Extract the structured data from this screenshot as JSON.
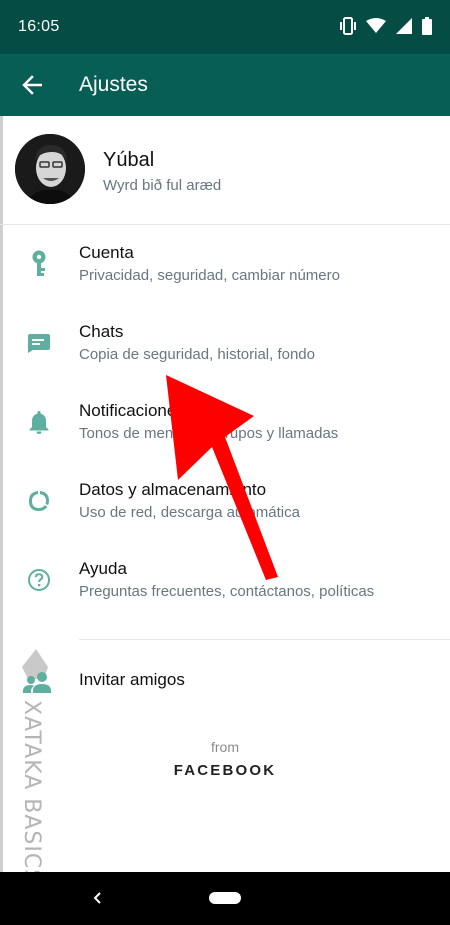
{
  "status_bar": {
    "time": "16:05",
    "icons": [
      "vibrate-icon",
      "wifi-icon",
      "signal-icon",
      "battery-icon"
    ]
  },
  "app_bar": {
    "title": "Ajustes",
    "back_icon": "arrow-back-icon"
  },
  "profile": {
    "name": "Yúbal",
    "status": "Wyrd bið ful aræd"
  },
  "menu": {
    "items": [
      {
        "title": "Cuenta",
        "subtitle": "Privacidad, seguridad, cambiar número",
        "icon": "key-icon"
      },
      {
        "title": "Chats",
        "subtitle": "Copia de seguridad, historial, fondo",
        "icon": "chat-icon"
      },
      {
        "title": "Notificaciones",
        "subtitle": "Tonos de mensajes, grupos y llamadas",
        "icon": "bell-icon"
      },
      {
        "title": "Datos y almacenamiento",
        "subtitle": "Uso de red, descarga automática",
        "icon": "data-usage-icon"
      },
      {
        "title": "Ayuda",
        "subtitle": "Preguntas frecuentes, contáctanos, políticas",
        "icon": "help-icon"
      }
    ]
  },
  "invite": {
    "label": "Invitar amigos",
    "icon": "people-icon"
  },
  "footer": {
    "from": "from",
    "brand": "FACEBOOK"
  },
  "watermark": "XATAKA BASICS",
  "colors": {
    "status_bar": "#054d44",
    "app_bar": "#075e54",
    "icon_teal": "#5fafa0",
    "annotation_arrow": "#ff0000"
  }
}
